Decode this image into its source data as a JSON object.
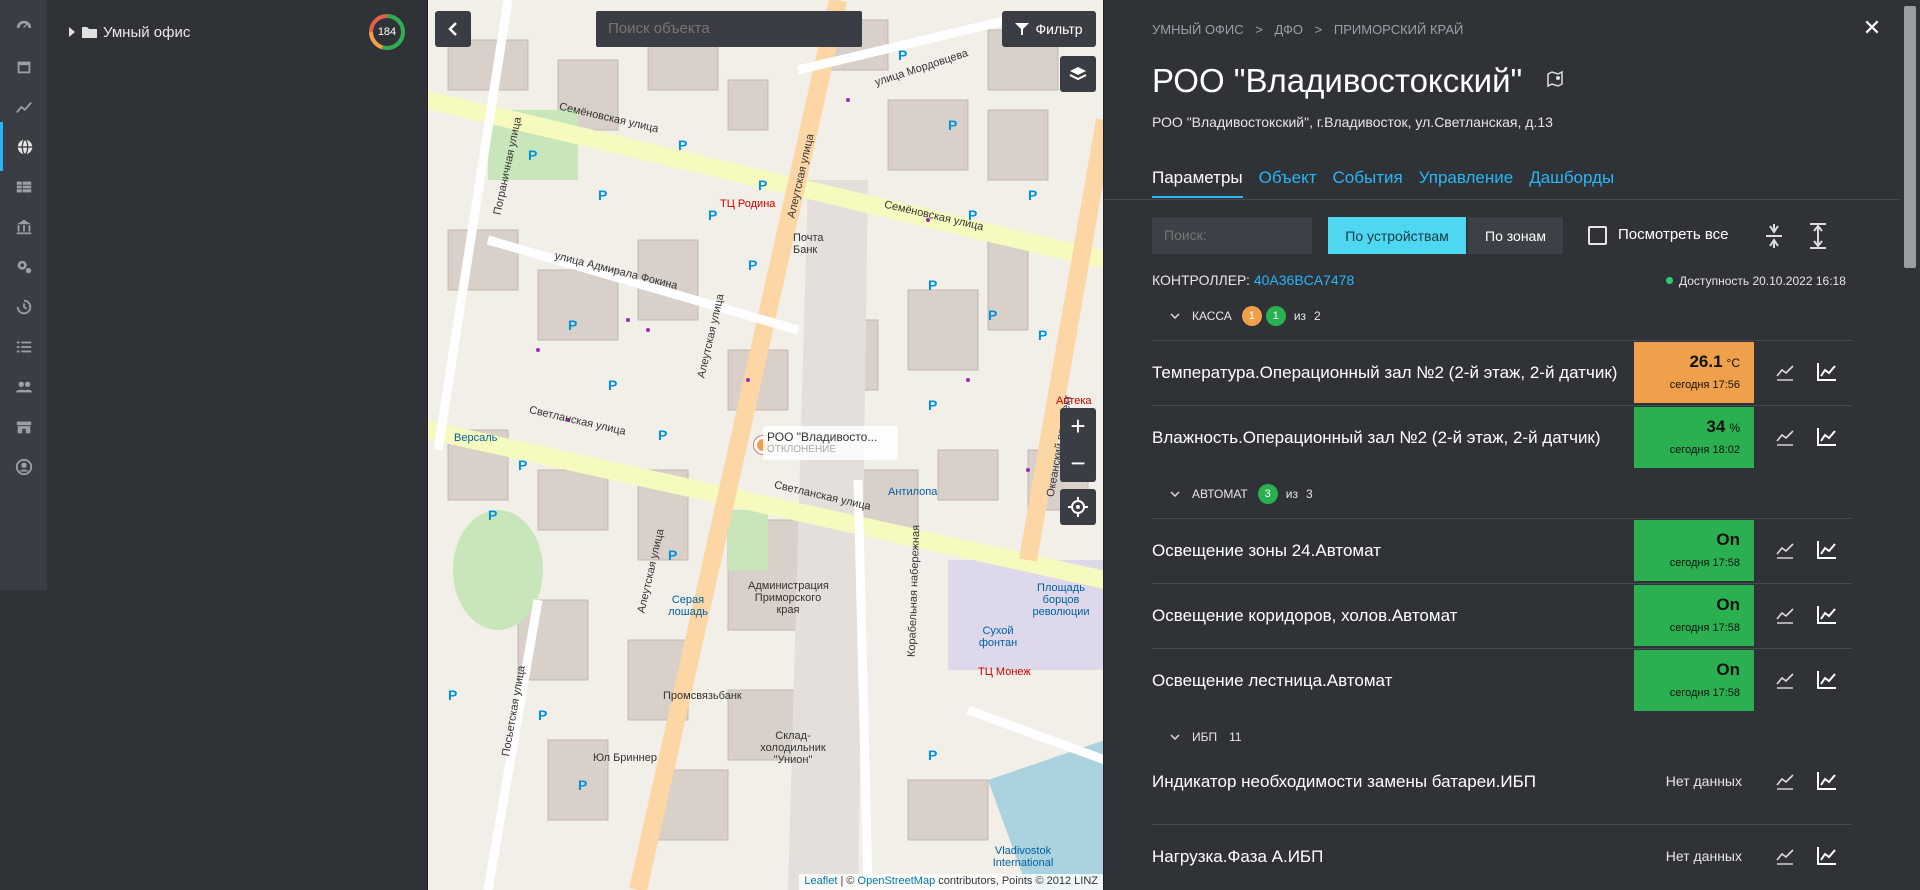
{
  "tree": {
    "root_label": "Умный офис",
    "object_count": "184"
  },
  "map": {
    "search_placeholder": "Поиск объекта",
    "filter_label": "Фильтр",
    "zoom_in": "+",
    "zoom_out": "−",
    "marker": {
      "name": "РОО \"Владивосто...",
      "status": "ОТКЛОНЕНИЕ"
    },
    "attribution": {
      "leaflet": "Leaflet",
      "sep": " | © ",
      "osm": "OpenStreetMap",
      "rest": " contributors, Points © 2012 LINZ"
    },
    "labels": [
      "улица Мордовцева",
      "Семёновская улица",
      "Пограничная улица",
      "Алеутская улица",
      "улица Адмирала Фокина",
      "Светланская улица",
      "Океанский проспект",
      "Посьетская улица",
      "Корабельная набережная",
      "ТЦ Родина",
      "Почта Банк",
      "Аптека",
      "Версаль",
      "Антилопа",
      "Администрация Приморского края",
      "Площадь борцов революции",
      "Сухой фонтан",
      "ТЦ Монеж",
      "Серая лошадь",
      "Промсвязьбанк",
      "Склад-холодильник \"Унион\"",
      "Юл Бриннер",
      "Vladivostok International",
      "Океанский проспект"
    ]
  },
  "detail": {
    "breadcrumb": [
      "УМНЫЙ ОФИС",
      ">",
      "ДФО",
      ">",
      "ПРИМОРСКИЙ КРАЙ"
    ],
    "title": "РОО \"Владивостокский\"",
    "address": "РОО \"Владивостокский\", г.Владивосток, ул.Светланская, д.13",
    "tabs": [
      "Параметры",
      "Объект",
      "События",
      "Управление",
      "Дашборды"
    ],
    "search_placeholder": "Поиск:",
    "btn_devices": "По устройствам",
    "btn_zones": "По зонам",
    "view_all": "Посмотреть все",
    "controller_label": "КОНТРОЛЛЕР:",
    "controller_id": "40A36BCA7478",
    "availability": "Доступность 20.10.2022 16:18",
    "groups": [
      {
        "name": "КАССА",
        "badge1": "1",
        "badge2": "1",
        "of": "из",
        "total": "2"
      },
      {
        "name": "АВТОМАТ",
        "badge1": "3",
        "of": "из",
        "total": "3"
      },
      {
        "name": "ИБП",
        "total": "11"
      }
    ],
    "rows": [
      {
        "name": "Температура.Операционный зал №2 (2-й этаж, 2-й датчик)",
        "value": "26.1",
        "unit": "°C",
        "time": "сегодня 17:56",
        "color": "#f0a04b"
      },
      {
        "name": "Влажность.Операционный зал №2 (2-й этаж, 2-й датчик)",
        "value": "34",
        "unit": "%",
        "time": "сегодня 18:02",
        "color": "#2ab050"
      },
      {
        "name": "Освещение зоны 24.Автомат",
        "value": "On",
        "unit": "",
        "time": "сегодня 17:58",
        "color": "#2ab050"
      },
      {
        "name": "Освещение коридоров, холов.Автомат",
        "value": "On",
        "unit": "",
        "time": "сегодня 17:58",
        "color": "#2ab050"
      },
      {
        "name": "Освещение лестница.Автомат",
        "value": "On",
        "unit": "",
        "time": "сегодня 17:58",
        "color": "#2ab050"
      },
      {
        "name": "Индикатор необходимости замены батареи.ИБП",
        "nodata": "Нет данных"
      },
      {
        "name": "Нагрузка.Фаза А.ИБП",
        "nodata": "Нет данных"
      }
    ],
    "colors": {
      "accent": "#29b6f6",
      "warning": "#f0a04b",
      "ok": "#2ab050",
      "toggle_active": "#4dd7f0"
    }
  },
  "rail_icons": [
    "dashboard-icon",
    "calendar-icon",
    "chart-icon",
    "globe-icon",
    "table-icon",
    "bank-icon",
    "settings-icon",
    "history-icon",
    "list-icon",
    "users-icon",
    "store-icon",
    "profile-icon"
  ]
}
